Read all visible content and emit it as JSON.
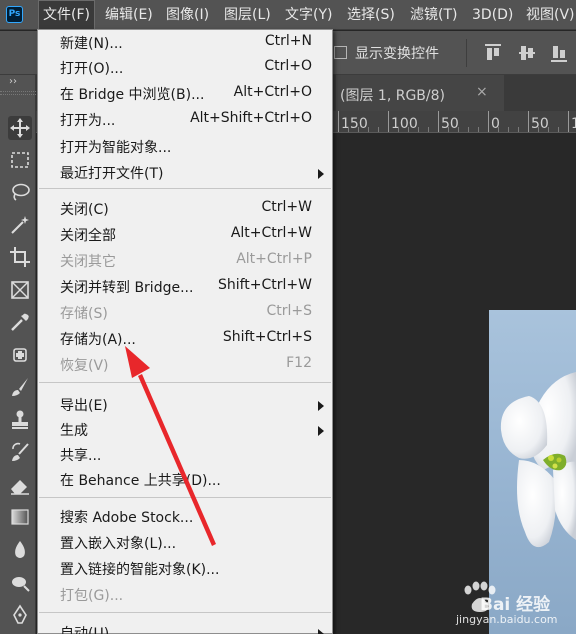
{
  "app": {
    "logo": "Ps"
  },
  "menubar": {
    "items": [
      "文件(F)",
      "编辑(E)",
      "图像(I)",
      "图层(L)",
      "文字(Y)",
      "选择(S)",
      "滤镜(T)",
      "3D(D)",
      "视图(V)"
    ]
  },
  "options_bar": {
    "transform_controls_label": "显示变换控件"
  },
  "toolbar": {
    "collapse_glyph": "››",
    "tools": [
      "move-tool",
      "marquee-tool",
      "lasso-tool",
      "magic-wand-tool",
      "crop-tool",
      "frame-tool",
      "eyedropper-tool",
      "healing-brush-tool",
      "brush-tool",
      "clone-stamp-tool",
      "history-brush-tool",
      "eraser-tool",
      "gradient-tool",
      "blur-tool",
      "dodge-tool",
      "pen-tool"
    ]
  },
  "document_tab": {
    "title": "(图层 1, RGB/8)",
    "close_glyph": "×"
  },
  "ruler": {
    "labels": [
      "150",
      "100",
      "50",
      "0",
      "50",
      "100"
    ]
  },
  "file_menu": {
    "items": [
      {
        "label": "新建(N)...",
        "shortcut": "Ctrl+N",
        "enabled": true,
        "submenu": false
      },
      {
        "label": "打开(O)...",
        "shortcut": "Ctrl+O",
        "enabled": true,
        "submenu": false
      },
      {
        "label": "在 Bridge 中浏览(B)...",
        "shortcut": "Alt+Ctrl+O",
        "enabled": true,
        "submenu": false
      },
      {
        "label": "打开为...",
        "shortcut": "Alt+Shift+Ctrl+O",
        "enabled": true,
        "submenu": false
      },
      {
        "label": "打开为智能对象...",
        "shortcut": "",
        "enabled": true,
        "submenu": false
      },
      {
        "label": "最近打开文件(T)",
        "shortcut": "",
        "enabled": true,
        "submenu": true
      },
      {
        "label": "关闭(C)",
        "shortcut": "Ctrl+W",
        "enabled": true,
        "submenu": false
      },
      {
        "label": "关闭全部",
        "shortcut": "Alt+Ctrl+W",
        "enabled": true,
        "submenu": false
      },
      {
        "label": "关闭其它",
        "shortcut": "Alt+Ctrl+P",
        "enabled": false,
        "submenu": false
      },
      {
        "label": "关闭并转到 Bridge...",
        "shortcut": "Shift+Ctrl+W",
        "enabled": true,
        "submenu": false
      },
      {
        "label": "存储(S)",
        "shortcut": "Ctrl+S",
        "enabled": false,
        "submenu": false
      },
      {
        "label": "存储为(A)...",
        "shortcut": "Shift+Ctrl+S",
        "enabled": true,
        "submenu": false
      },
      {
        "label": "恢复(V)",
        "shortcut": "F12",
        "enabled": false,
        "submenu": false
      },
      {
        "label": "导出(E)",
        "shortcut": "",
        "enabled": true,
        "submenu": true
      },
      {
        "label": "生成",
        "shortcut": "",
        "enabled": true,
        "submenu": true
      },
      {
        "label": "共享...",
        "shortcut": "",
        "enabled": true,
        "submenu": false
      },
      {
        "label": "在 Behance 上共享(D)...",
        "shortcut": "",
        "enabled": true,
        "submenu": false
      },
      {
        "label": "搜索 Adobe Stock...",
        "shortcut": "",
        "enabled": true,
        "submenu": false
      },
      {
        "label": "置入嵌入对象(L)...",
        "shortcut": "",
        "enabled": true,
        "submenu": false
      },
      {
        "label": "置入链接的智能对象(K)...",
        "shortcut": "",
        "enabled": true,
        "submenu": false
      },
      {
        "label": "打包(G)...",
        "shortcut": "",
        "enabled": false,
        "submenu": false
      },
      {
        "label": "自动(U)",
        "shortcut": "",
        "enabled": true,
        "submenu": true
      }
    ]
  },
  "watermark": {
    "brand": "Bai 经验",
    "url": "jingyan.baidu.com"
  },
  "colors": {
    "chrome": "#535353",
    "canvas_bg": "#262626",
    "menu_bg": "#f0f0f0",
    "annotation_red": "#e8272b"
  }
}
